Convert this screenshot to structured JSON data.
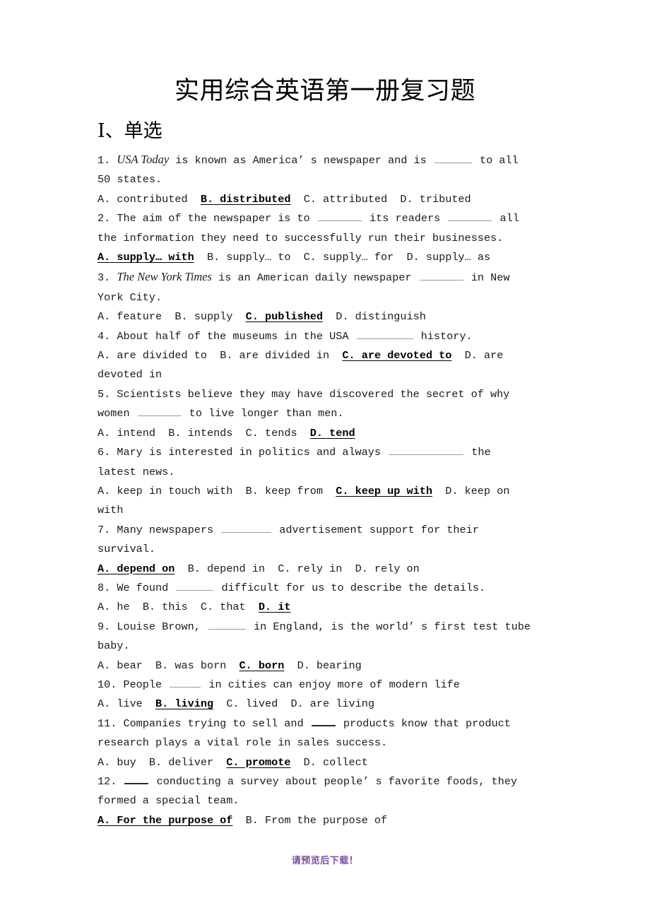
{
  "document": {
    "title": "实用综合英语第一册复习题",
    "section_heading": "Ⅰ、单选",
    "footer_note": "请预览后下载！",
    "footer_color": "#7d4fa6"
  },
  "lines": {
    "l1": "1. ",
    "l1_italic": "USA Today",
    "l1b": " is known as America’ s newspaper and is ",
    "l1c": " to all",
    "l2": "50 states.",
    "l3a": "A. contributed",
    "l3b": "B. distributed",
    "l3c": "C. attributed",
    "l3d": "D. tributed",
    "l4a": "2. The aim of the newspaper is to ",
    "l4b": " its readers ",
    "l4c": " all",
    "l5": "the information they need to successfully run their businesses.",
    "l6a": "A. supply… with",
    "l6b": "B. supply… to",
    "l6c": "C. supply… for",
    "l6d": "D. supply… as",
    "l7a": "3. ",
    "l7_italic": "The New York Times",
    "l7b": " is an American daily newspaper ",
    "l7c": " in New",
    "l8": "York City.",
    "l9a": "A. feature",
    "l9b": "B. supply",
    "l9c": "C. published",
    "l9d": "D. distinguish",
    "l10a": "4. About half of the museums in the USA ",
    "l10b": " history.",
    "l11a": "A. are divided to",
    "l11b": "B. are divided in",
    "l11c": "C. are devoted to",
    "l11d": "D. are",
    "l12": "devoted in",
    "l13": "5. Scientists believe they may have discovered the secret of why",
    "l14a": "women ",
    "l14b": " to live longer than men.",
    "l15a": "A. intend",
    "l15b": "B. intends",
    "l15c": "C. tends",
    "l15d": "D. tend",
    "l16a": "6. Mary is interested in politics and always ",
    "l16b": " the",
    "l17": "latest news.",
    "l18a": "A. keep in touch with",
    "l18b": "B. keep from",
    "l18c": "C. keep up with",
    "l18d": "D. keep on",
    "l19": "with",
    "l20a": "7. Many newspapers ",
    "l20b": " advertisement support for their",
    "l21": "survival.",
    "l22a": "A. depend on",
    "l22b": "B. depend in",
    "l22c": "C. rely in",
    "l22d": "D. rely on",
    "l23a": "8. We found ",
    "l23b": " difficult for us to describe the details.",
    "l24a": "A. he",
    "l24b": "B. this",
    "l24c": "C. that",
    "l24d": "D. it",
    "l25a": "9. Louise Brown, ",
    "l25b": " in England, is the world’ s first test tube",
    "l26": "baby.",
    "l27a": "A. bear",
    "l27b": "B. was born",
    "l27c": "C. born",
    "l27d": "D. bearing",
    "l28a": "10. People ",
    "l28b": " in cities can enjoy more of modern life",
    "l29a": "A. live",
    "l29b": "B. living",
    "l29c": "C. lived",
    "l29d": "D. are living",
    "l30a": "11. Companies trying to sell and ",
    "l30b": " products know that product",
    "l31": "research plays a vital role in sales success.",
    "l32a": "A. buy",
    "l32b": "B. deliver",
    "l32c": "C. promote",
    "l32d": "D. collect",
    "l33a": "12. ",
    "l33b": " conducting a survey about people’ s favorite foods, they",
    "l34": "formed a special team.",
    "l35a": "A. For the purpose of",
    "l35b": "B. From the purpose of"
  }
}
